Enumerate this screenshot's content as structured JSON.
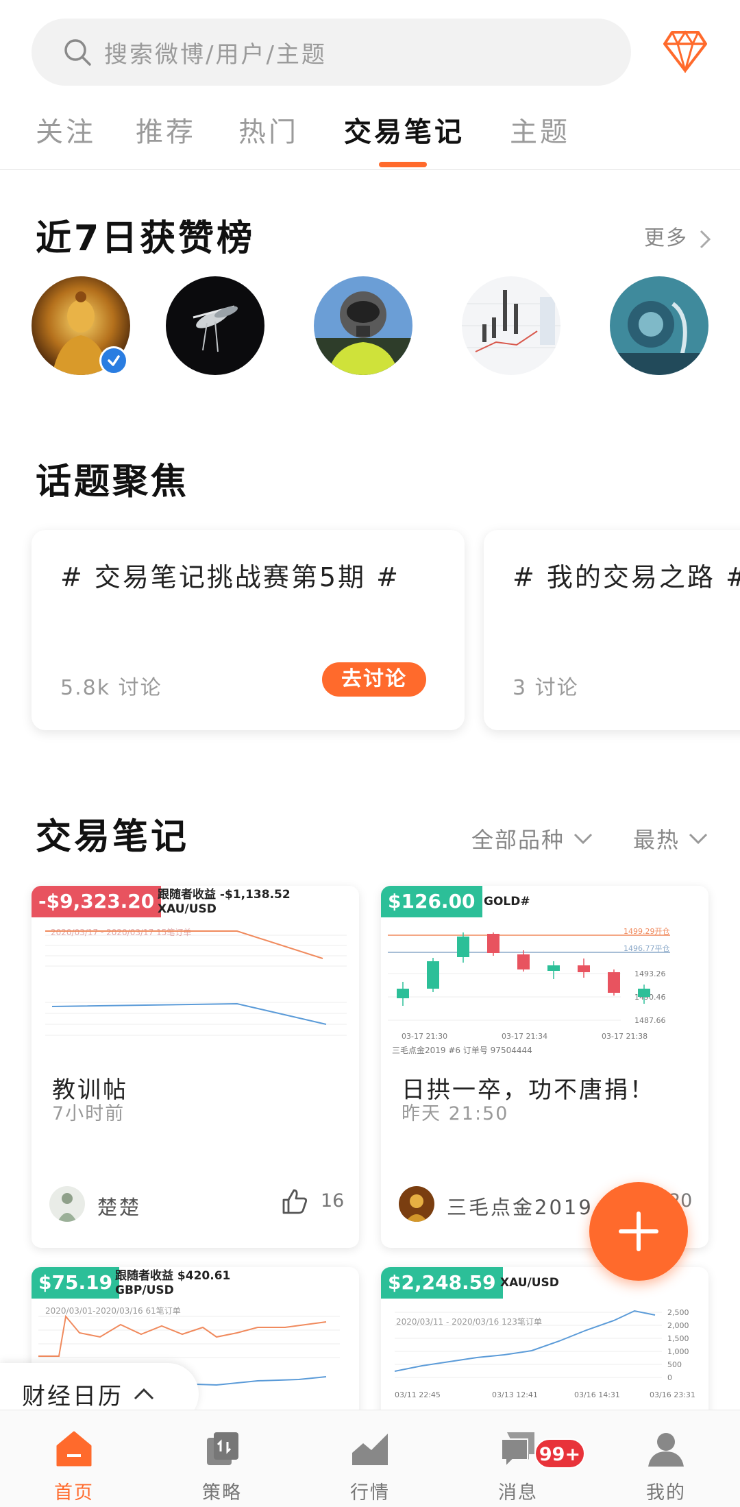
{
  "search": {
    "placeholder": "搜索微博/用户/主题"
  },
  "tabs": [
    {
      "label": "关注"
    },
    {
      "label": "推荐"
    },
    {
      "label": "热门"
    },
    {
      "label": "交易笔记"
    },
    {
      "label": "主题"
    }
  ],
  "active_tab": "交易笔记",
  "leaderboard": {
    "title": "近7日获赞榜",
    "more_label": "更多"
  },
  "topics": {
    "title": "话题聚焦",
    "cards": [
      {
        "title": "# 交易笔记挑战赛第5期 #",
        "count": "5.8k 讨论",
        "button": "去讨论"
      },
      {
        "title": "# 我的交易之路 #",
        "count": "3 讨论"
      }
    ]
  },
  "notes": {
    "title": "交易笔记",
    "filter_symbol": "全部品种",
    "filter_sort": "最热",
    "cards": [
      {
        "pnl": "-$9,323.20",
        "follower_label": "跟随者收益 -$1,138.52",
        "symbol": "XAU/USD",
        "chart_caption": "2020/03/17 - 2020/03/17  15笔订单",
        "title": "教训帖",
        "time": "7小时前",
        "author": "楚楚",
        "likes": "16"
      },
      {
        "pnl": "$126.00",
        "symbol": "GOLD#",
        "open_label": "1499.29开仓",
        "close_label": "1496.77平仓",
        "price_ticks": [
          "1493.26",
          "1490.46",
          "1487.66"
        ],
        "time_ticks": [
          "03-17 21:30",
          "03-17 21:34",
          "03-17 21:38"
        ],
        "chart_caption": "三毛点金2019 #6   订单号 97504444",
        "title": "日拱一卒，功不唐捐！",
        "time": "昨天 21:50",
        "author": "三毛点金2019",
        "likes": "20"
      },
      {
        "pnl": "$75.19",
        "follower_label": "跟随者收益 $420.61",
        "symbol": "GBP/USD",
        "chart_caption": "2020/03/01-2020/03/16 61笔订单"
      },
      {
        "pnl": "$2,248.59",
        "symbol": "XAU/USD",
        "chart_caption": "2020/03/11 - 2020/03/16  123笔订单",
        "y_ticks": [
          "2,500",
          "2,000",
          "1,500",
          "1,000",
          "500",
          "0"
        ],
        "x_ticks": [
          "03/11 22:45",
          "03/13 12:41",
          "03/16 14:31",
          "03/16 23:31"
        ]
      }
    ]
  },
  "calendar": {
    "label": "财经日历"
  },
  "nav": {
    "items": [
      {
        "label": "首页"
      },
      {
        "label": "策略"
      },
      {
        "label": "行情"
      },
      {
        "label": "消息"
      },
      {
        "label": "我的"
      }
    ],
    "message_badge": "99+"
  },
  "colors": {
    "accent": "#ff6a2c",
    "loss": "#e8535f",
    "profit": "#2cbf98",
    "badge": "#e8333a"
  }
}
